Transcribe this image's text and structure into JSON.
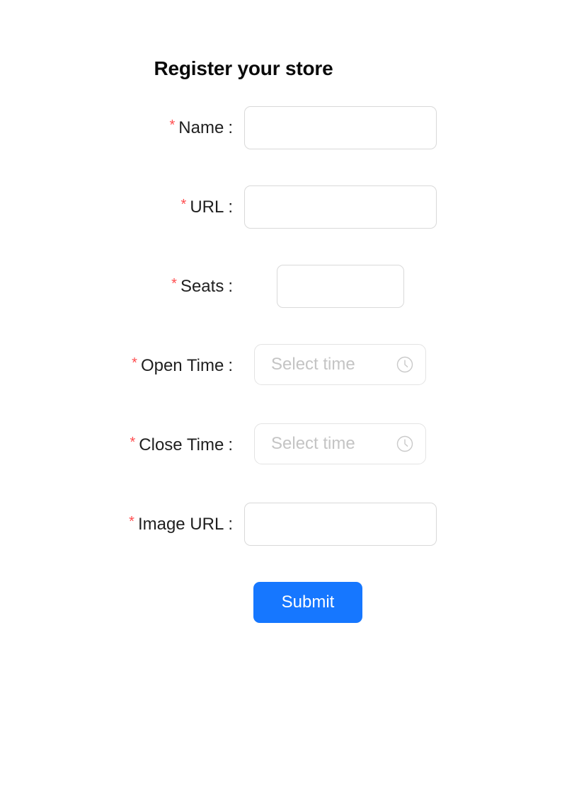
{
  "page": {
    "title": "Register your store",
    "background_color": "#ffffff"
  },
  "theme": {
    "primary_color": "#1677ff",
    "required_mark_color": "#ff4d4f",
    "border_color": "#d9d9d9",
    "placeholder_color": "#c4c4c4",
    "label_color": "rgba(0,0,0,0.88)"
  },
  "form": {
    "fields": [
      {
        "key": "name",
        "label": "Name",
        "colon": ":",
        "required": true,
        "required_mark": "*",
        "control": "text-input",
        "value": "",
        "placeholder": ""
      },
      {
        "key": "url",
        "label": "URL",
        "colon": ":",
        "required": true,
        "required_mark": "*",
        "control": "text-input",
        "value": "",
        "placeholder": ""
      },
      {
        "key": "seats",
        "label": "Seats",
        "colon": ":",
        "required": true,
        "required_mark": "*",
        "control": "number-input",
        "value": "",
        "placeholder": ""
      },
      {
        "key": "open_time",
        "label": "Open Time",
        "colon": ":",
        "required": true,
        "required_mark": "*",
        "control": "time-picker",
        "value": "",
        "placeholder": "Select time",
        "icon": "clock-icon"
      },
      {
        "key": "close_time",
        "label": "Close Time",
        "colon": ":",
        "required": true,
        "required_mark": "*",
        "control": "time-picker",
        "value": "",
        "placeholder": "Select time",
        "icon": "clock-icon"
      },
      {
        "key": "image_url",
        "label": "Image URL",
        "colon": ":",
        "required": true,
        "required_mark": "*",
        "control": "text-input",
        "value": "",
        "placeholder": ""
      }
    ],
    "submit": {
      "label": "Submit"
    }
  }
}
